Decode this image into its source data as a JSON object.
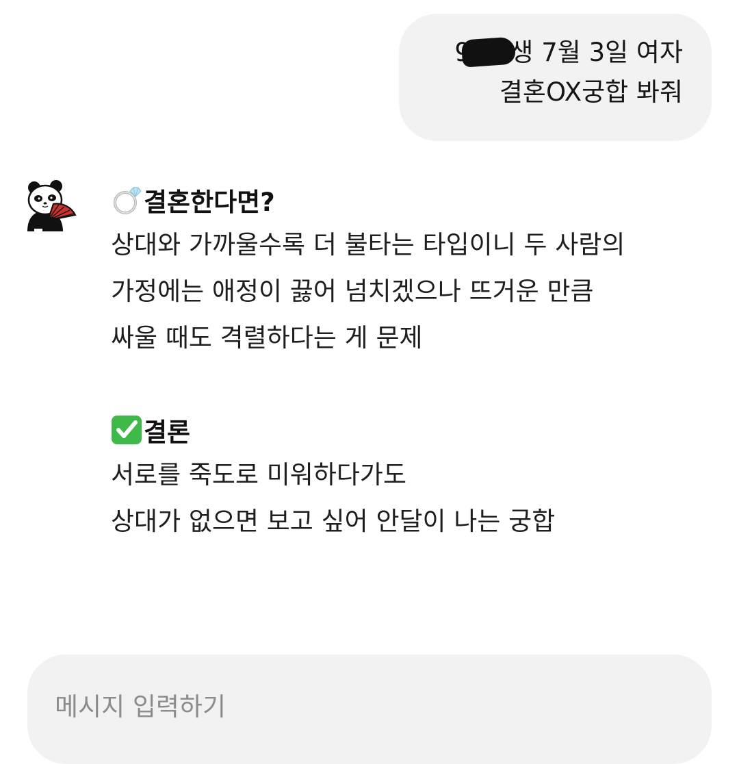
{
  "user_message": {
    "line1": "96년생 7월 3일 여자",
    "line2": "결혼OX궁합 봐줘"
  },
  "bot_message": {
    "avatar_icon": "panda-with-fan-icon",
    "section1": {
      "icon": "ring-icon",
      "title": "결혼한다면?",
      "lines": [
        "상대와 가까울수록 더 불타는 타입이니 두 사람의",
        "가정에는 애정이 끓어 넘치겠으나 뜨거운 만큼",
        "싸울 때도 격렬하다는 게 문제"
      ]
    },
    "section2": {
      "icon": "check-mark-icon",
      "title": "결론",
      "lines": [
        "서로를 죽도로 미워하다가도",
        "상대가 없으면 보고 싶어 안달이 나는 궁합"
      ]
    }
  },
  "input": {
    "placeholder": "메시지 입력하기"
  },
  "colors": {
    "bubble_bg": "#f2f2f2",
    "check_green": "#3fb94a",
    "fan_red": "#c8332c"
  }
}
